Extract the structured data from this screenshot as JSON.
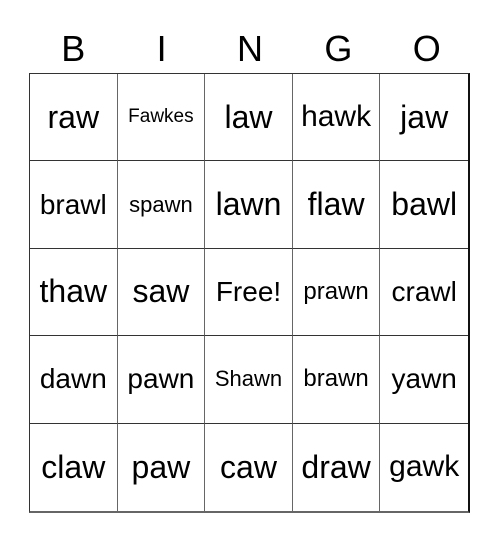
{
  "header": {
    "letters": [
      "B",
      "I",
      "N",
      "G",
      "O"
    ]
  },
  "grid": {
    "rows": [
      [
        "raw",
        "Fawkes",
        "law",
        "hawk",
        "jaw"
      ],
      [
        "brawl",
        "spawn",
        "lawn",
        "flaw",
        "bawl"
      ],
      [
        "thaw",
        "saw",
        "Free!",
        "prawn",
        "crawl"
      ],
      [
        "dawn",
        "pawn",
        "Shawn",
        "brawn",
        "yawn"
      ],
      [
        "claw",
        "paw",
        "caw",
        "draw",
        "gawk"
      ]
    ]
  }
}
